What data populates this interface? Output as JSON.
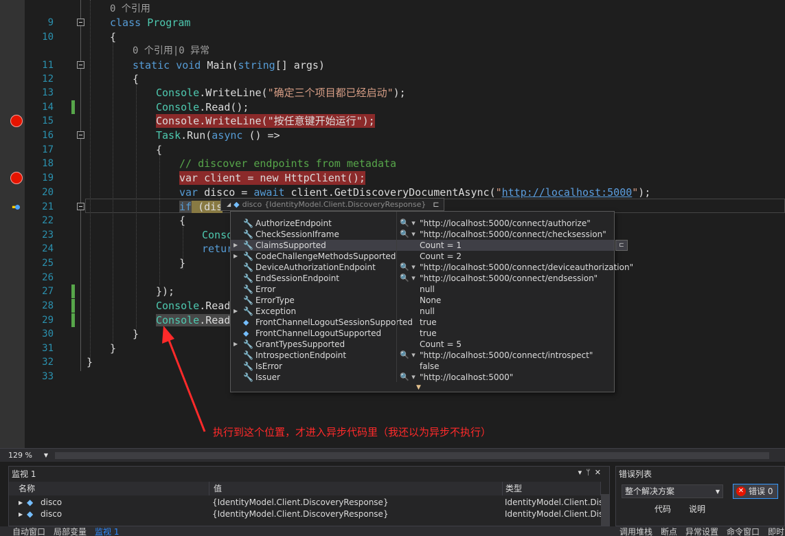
{
  "editor": {
    "line_numbers": [
      "9",
      "10",
      "11",
      "12",
      "13",
      "14",
      "15",
      "16",
      "17",
      "18",
      "19",
      "20",
      "21",
      "22",
      "23",
      "24",
      "25",
      "26",
      "27",
      "28",
      "29",
      "30",
      "31",
      "32",
      "33"
    ],
    "codelens_top": "0 个引用",
    "codelens_main": "0 个引用|0 异常",
    "tokens": {
      "class_kw": "class",
      "program": "Program",
      "brace_open": "{",
      "brace_close": "}",
      "static": "static",
      "void": "void",
      "main": " Main(",
      "string": "string",
      "args": "[] args)",
      "console": "Console",
      "writeline": ".WriteLine(",
      "read_call": ".Read();",
      "str_confirm": "\"确定三个项目都已经启动\"",
      "str_press": "\"按任意键开始运行\"",
      "close_paren_semi": ");",
      "task": "Task",
      "run": ".Run(",
      "async": "async",
      "lambda": " () =>",
      "comment": "// discover endpoints from metadata",
      "var": "var",
      "client_eq": " client = ",
      "new": "new",
      "httpclient": "HttpClient",
      "paren_semi": "();",
      "disco_eq": " disco = ",
      "await": "await",
      "getdisc": " client.GetDiscoveryDocumentAsync(",
      "quote": "\"",
      "url": "http://localhost:5000",
      "close_task": "});",
      "if": "if",
      "if_rest": " (dis",
      "console_tail_23": "Conso",
      "return_tail": "retur",
      "readl": ".ReadL",
      "readk": ".ReadK"
    }
  },
  "datatip": {
    "header_name": "disco",
    "header_type": "{IdentityModel.Client.DiscoveryResponse}",
    "rows": [
      {
        "name": "AuthorizeEndpoint",
        "value": "\"http://localhost:5000/connect/authorize\"",
        "icon": "wrench-icon",
        "expandable": false,
        "magnifier": true
      },
      {
        "name": "CheckSessionIframe",
        "value": "\"http://localhost:5000/connect/checksession\"",
        "icon": "wrench-icon",
        "expandable": false,
        "magnifier": true
      },
      {
        "name": "ClaimsSupported",
        "value": "Count = 1",
        "icon": "wrench-icon",
        "expandable": true,
        "magnifier": false
      },
      {
        "name": "CodeChallengeMethodsSupported",
        "value": "Count = 2",
        "icon": "wrench-icon",
        "expandable": true,
        "magnifier": false
      },
      {
        "name": "DeviceAuthorizationEndpoint",
        "value": "\"http://localhost:5000/connect/deviceauthorization\"",
        "icon": "wrench-icon",
        "expandable": false,
        "magnifier": true
      },
      {
        "name": "EndSessionEndpoint",
        "value": "\"http://localhost:5000/connect/endsession\"",
        "icon": "wrench-icon",
        "expandable": false,
        "magnifier": true
      },
      {
        "name": "Error",
        "value": "null",
        "icon": "wrench-icon",
        "expandable": false,
        "magnifier": false
      },
      {
        "name": "ErrorType",
        "value": "None",
        "icon": "wrench-icon",
        "expandable": false,
        "magnifier": false
      },
      {
        "name": "Exception",
        "value": "null",
        "icon": "wrench-icon",
        "expandable": true,
        "magnifier": false
      },
      {
        "name": "FrontChannelLogoutSessionSupported",
        "value": "true",
        "icon": "property-icon",
        "expandable": false,
        "magnifier": false
      },
      {
        "name": "FrontChannelLogoutSupported",
        "value": "true",
        "icon": "property-icon",
        "expandable": false,
        "magnifier": false
      },
      {
        "name": "GrantTypesSupported",
        "value": "Count = 5",
        "icon": "wrench-icon",
        "expandable": true,
        "magnifier": false
      },
      {
        "name": "IntrospectionEndpoint",
        "value": "\"http://localhost:5000/connect/introspect\"",
        "icon": "wrench-icon",
        "expandable": false,
        "magnifier": true
      },
      {
        "name": "IsError",
        "value": "false",
        "icon": "wrench-icon",
        "expandable": false,
        "magnifier": false
      },
      {
        "name": "Issuer",
        "value": "\"http://localhost:5000\"",
        "icon": "wrench-icon",
        "expandable": false,
        "magnifier": true
      }
    ]
  },
  "annotation": {
    "text": "执行到这个位置，才进入异步代码里（我还以为异步不执行）",
    "color": "#ff2a2a"
  },
  "zoom": {
    "value": "129 %"
  },
  "watch": {
    "title": "监视 1",
    "columns": [
      "名称",
      "值",
      "类型"
    ],
    "rows": [
      {
        "name": "disco",
        "value": "{IdentityModel.Client.DiscoveryResponse}",
        "type": "IdentityModel.Client.Dis..."
      },
      {
        "name": "disco",
        "value": "{IdentityModel.Client.DiscoveryResponse}",
        "type": "IdentityModel.Client.Dis..."
      }
    ]
  },
  "errors": {
    "title": "错误列表",
    "scope": "整个解决方案",
    "error_button": "错误 0",
    "columns": [
      "代码",
      "说明"
    ]
  },
  "bottom_tabs_left": [
    "自动窗口",
    "局部变量",
    "监视 1"
  ],
  "bottom_tabs_right": [
    "调用堆栈",
    "断点",
    "异常设置",
    "命令窗口",
    "即时"
  ],
  "colors": {
    "breakpoint": "#e51400",
    "keyword": "#569cd6",
    "type": "#4ec9b0",
    "string": "#d69d85",
    "comment": "#57a64a"
  }
}
